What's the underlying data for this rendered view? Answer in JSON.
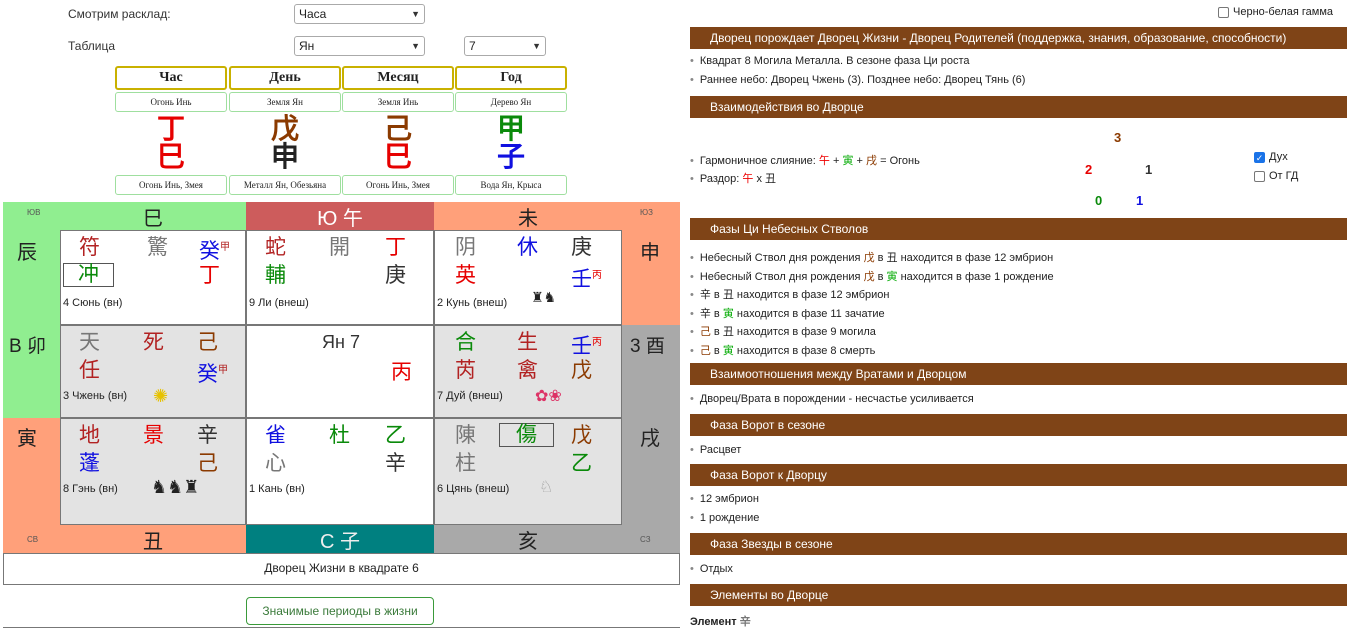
{
  "controls": {
    "layout_label": "Смотрим расклад:",
    "layout_value": "Часа",
    "table_label": "Таблица",
    "table_value": "Ян",
    "table_num": "7",
    "bw_label": "Черно-белая гамма"
  },
  "pillars": [
    {
      "name": "Час",
      "sub": "Огонь Инь",
      "stem": "丁",
      "branch": "巳",
      "foot": "Огонь Инь, Змея",
      "stem_color": "#e60000",
      "branch_color": "#e60000"
    },
    {
      "name": "День",
      "sub": "Земля Ян",
      "stem": "戊",
      "branch": "申",
      "foot": "Металл Ян, Обезьяна",
      "stem_color": "#8b3a00",
      "branch_color": "#222222"
    },
    {
      "name": "Месяц",
      "sub": "Земля Инь",
      "stem": "己",
      "branch": "巳",
      "foot": "Огонь Инь, Змея",
      "stem_color": "#8b3a00",
      "branch_color": "#e60000"
    },
    {
      "name": "Год",
      "sub": "Дерево Ян",
      "stem": "甲",
      "branch": "子",
      "foot": "Вода Ян, Крыса",
      "stem_color": "#0a8a0a",
      "branch_color": "#1010e0"
    }
  ],
  "grid": {
    "top_labels": [
      "ЮВ",
      "巳",
      "Ю 午",
      "未",
      "ЮЗ"
    ],
    "bottom_labels": [
      "СВ",
      "丑",
      "С 子",
      "亥",
      "СЗ"
    ],
    "left_labels": [
      "辰",
      "В 卯",
      "寅"
    ],
    "right_labels": [
      "申",
      "3 酉",
      "戌"
    ],
    "center": "Ян 7",
    "footer": "Дворец Жизни в квадрате 6",
    "p4": {
      "r1": [
        "符",
        "驚",
        "癸"
      ],
      "r1sup": "甲",
      "boxed": "冲",
      "r2c": "丁",
      "name": "4 Сюнь (вн)"
    },
    "p9": {
      "r1": [
        "蛇",
        "開",
        "丁"
      ],
      "r2": [
        "輔",
        "庚"
      ],
      "name": "9 Ли (внеш)"
    },
    "p2": {
      "r1": [
        "阴",
        "休",
        "庚"
      ],
      "r2": [
        "英",
        "壬"
      ],
      "sup": "丙",
      "name": "2 Кунь (внеш)"
    },
    "p3": {
      "r1": [
        "天",
        "死",
        "己"
      ],
      "r2": [
        "任",
        "癸"
      ],
      "sup": "甲",
      "name": "3 Чжень (вн)"
    },
    "p7": {
      "r1": [
        "合",
        "生",
        "壬"
      ],
      "sup": "丙",
      "r2": [
        "芮",
        "禽",
        "戊"
      ],
      "name": "7 Дуй (внеш)"
    },
    "p8": {
      "r1": [
        "地",
        "景",
        "辛"
      ],
      "r2": [
        "蓬",
        "己"
      ],
      "name": "8 Гэнь (вн)"
    },
    "p1": {
      "r1": [
        "雀",
        "杜",
        "乙"
      ],
      "r2": [
        "心",
        "辛"
      ],
      "name": "1 Кань (вн)"
    },
    "p6": {
      "r1": [
        "陳",
        "傷",
        "戊"
      ],
      "r2": [
        "柱",
        "乙"
      ],
      "name": "6 Цянь (внеш)"
    }
  },
  "periods_button": "Значимые периоды в жизни",
  "right": {
    "h1": "Дворец порождает Дворец Жизни - Дворец Родителей (поддержка, знания, образование, способности)",
    "l1": "Квадрат 8 Могила Металла. В сезоне фаза Ци роста",
    "l2": "Раннее небо: Дворец Чжень (3). Позднее небо: Дворец Тянь (6)",
    "h2": "Взаимодействия во Дворце",
    "harm_prefix": "Гармоничное слияние:",
    "harm_a": "午",
    "harm_plus1": "+",
    "harm_b": "寅",
    "harm_plus2": "+",
    "harm_c": "戌",
    "harm_res": "= Огонь",
    "split_prefix": "Раздор:",
    "split_a": "午",
    "split_x": "х",
    "split_b": "丑",
    "nums": {
      "top": "3",
      "ml": "2",
      "mr": "1",
      "bl": "0",
      "br": "1"
    },
    "chk_spirit": "Дух",
    "chk_gd": "От ГД",
    "h3": "Фазы Ци Небесных Стволов",
    "phase": [
      {
        "pre": "Небесный Ствол дня рождения",
        "g1": "戊",
        "mid": "в",
        "g2": "丑",
        "post": "находится в фазе 12 эмбрион"
      },
      {
        "pre": "Небесный Ствол дня рождения",
        "g1": "戊",
        "mid": "в",
        "g2": "寅",
        "post": "находится в фазе 1 рождение"
      },
      {
        "pre": "",
        "g1": "辛",
        "mid": "в",
        "g2": "丑",
        "post": "находится в фазе 12 эмбрион"
      },
      {
        "pre": "",
        "g1": "辛",
        "mid": "в",
        "g2": "寅",
        "post": "находится в фазе 11 зачатие"
      },
      {
        "pre": "",
        "g1": "己",
        "mid": "в",
        "g2": "丑",
        "post": "находится в фазе 9 могила"
      },
      {
        "pre": "",
        "g1": "己",
        "mid": "в",
        "g2": "寅",
        "post": "находится в фазе 8 смерть"
      }
    ],
    "h4": "Взаимоотношения между Вратами и Дворцом",
    "l4": "Дворец/Врата в порождении - несчастье усиливается",
    "h5": "Фаза Ворот в сезоне",
    "l5": "Расцвет",
    "h6": "Фаза Ворот к Дворцу",
    "l6a": "12 эмбрион",
    "l6b": "1 рождение",
    "h7": "Фаза Звезды в сезоне",
    "l7": "Отдых",
    "h8": "Элементы во Дворце",
    "l8_label": "Элемент",
    "l8_glyph": "辛"
  },
  "colors": {
    "accent_bar": "#7f4417",
    "green_cell": "#90ee90",
    "red_cell": "#cd5c5c",
    "orange_cell": "#ffa07a",
    "teal_cell": "#008080",
    "grey_cell": "#a9a9a9"
  }
}
